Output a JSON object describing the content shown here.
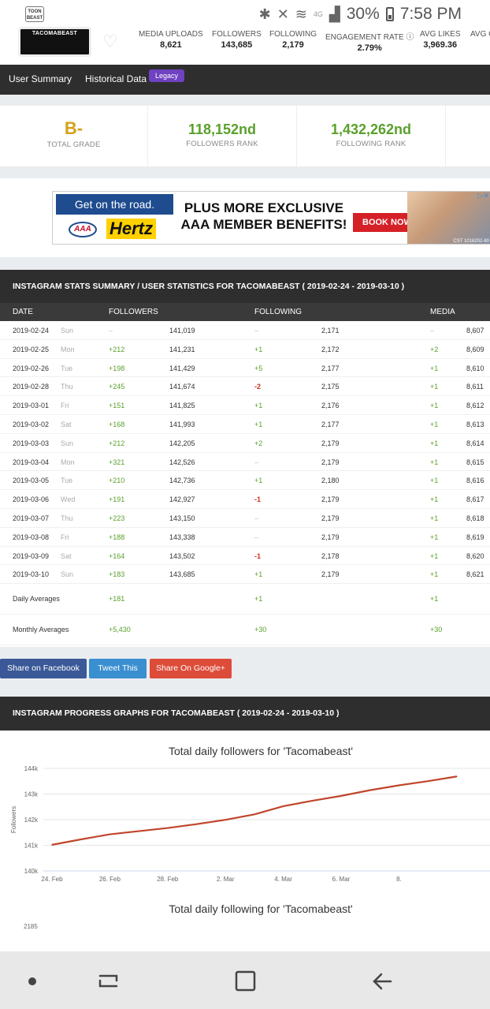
{
  "statusbar": {
    "battery": "30%",
    "time": "7:58 PM",
    "network": "4G",
    "app_badge": "TOON BEAST"
  },
  "profile": {
    "avatar_text": "TACOMABEAST",
    "stats": [
      {
        "label": "MEDIA UPLOADS",
        "value": "8,621"
      },
      {
        "label": "FOLLOWERS",
        "value": "143,685"
      },
      {
        "label": "FOLLOWING",
        "value": "2,179"
      },
      {
        "label": "ENGAGEMENT RATE",
        "value": "2.79%"
      },
      {
        "label": "AVG LIKES",
        "value": "3,969.36"
      },
      {
        "label": "AVG C",
        "value": ""
      }
    ]
  },
  "nav": {
    "user_summary": "User Summary",
    "historical": "Historical Data",
    "legacy": "Legacy"
  },
  "grades": {
    "total": {
      "value": "B-",
      "label": "TOTAL GRADE"
    },
    "followers_rank": {
      "value": "118,152nd",
      "label": "FOLLOWERS RANK"
    },
    "following_rank": {
      "value": "1,432,262nd",
      "label": "FOLLOWING RANK"
    }
  },
  "ad": {
    "line1": "Get on the road.",
    "brand_aaa": "AAA",
    "brand": "Hertz",
    "headline1": "PLUS MORE EXCLUSIVE",
    "headline2": "AAA MEMBER BENEFITS!",
    "cta": "BOOK NOW",
    "fine": "CST 1016202-80"
  },
  "stats_table": {
    "title": "INSTAGRAM STATS SUMMARY / USER STATISTICS FOR TACOMABEAST ( 2019-02-24 - 2019-03-10 )",
    "headers": {
      "date": "DATE",
      "followers": "FOLLOWERS",
      "following": "FOLLOWING",
      "media": "MEDIA"
    },
    "rows": [
      {
        "date": "2019-02-24",
        "day": "Sun",
        "fd": "–",
        "f": "141,019",
        "gd": "–",
        "g": "2,171",
        "md": "–",
        "m": "8,607"
      },
      {
        "date": "2019-02-25",
        "day": "Mon",
        "fd": "+212",
        "f": "141,231",
        "gd": "+1",
        "g": "2,172",
        "md": "+2",
        "m": "8,609"
      },
      {
        "date": "2019-02-26",
        "day": "Tue",
        "fd": "+198",
        "f": "141,429",
        "gd": "+5",
        "g": "2,177",
        "md": "+1",
        "m": "8,610"
      },
      {
        "date": "2019-02-28",
        "day": "Thu",
        "fd": "+245",
        "f": "141,674",
        "gd": "-2",
        "g": "2,175",
        "md": "+1",
        "m": "8,611"
      },
      {
        "date": "2019-03-01",
        "day": "Fri",
        "fd": "+151",
        "f": "141,825",
        "gd": "+1",
        "g": "2,176",
        "md": "+1",
        "m": "8,612"
      },
      {
        "date": "2019-03-02",
        "day": "Sat",
        "fd": "+168",
        "f": "141,993",
        "gd": "+1",
        "g": "2,177",
        "md": "+1",
        "m": "8,613"
      },
      {
        "date": "2019-03-03",
        "day": "Sun",
        "fd": "+212",
        "f": "142,205",
        "gd": "+2",
        "g": "2,179",
        "md": "+1",
        "m": "8,614"
      },
      {
        "date": "2019-03-04",
        "day": "Mon",
        "fd": "+321",
        "f": "142,526",
        "gd": "–",
        "g": "2,179",
        "md": "+1",
        "m": "8,615"
      },
      {
        "date": "2019-03-05",
        "day": "Tue",
        "fd": "+210",
        "f": "142,736",
        "gd": "+1",
        "g": "2,180",
        "md": "+1",
        "m": "8,616"
      },
      {
        "date": "2019-03-06",
        "day": "Wed",
        "fd": "+191",
        "f": "142,927",
        "gd": "-1",
        "g": "2,179",
        "md": "+1",
        "m": "8,617"
      },
      {
        "date": "2019-03-07",
        "day": "Thu",
        "fd": "+223",
        "f": "143,150",
        "gd": "–",
        "g": "2,179",
        "md": "+1",
        "m": "8,618"
      },
      {
        "date": "2019-03-08",
        "day": "Fri",
        "fd": "+188",
        "f": "143,338",
        "gd": "–",
        "g": "2,179",
        "md": "+1",
        "m": "8,619"
      },
      {
        "date": "2019-03-09",
        "day": "Sat",
        "fd": "+164",
        "f": "143,502",
        "gd": "-1",
        "g": "2,178",
        "md": "+1",
        "m": "8,620"
      },
      {
        "date": "2019-03-10",
        "day": "Sun",
        "fd": "+183",
        "f": "143,685",
        "gd": "+1",
        "g": "2,179",
        "md": "+1",
        "m": "8,621"
      }
    ],
    "daily_avg": {
      "label": "Daily Averages",
      "f": "+181",
      "g": "+1",
      "m": "+1"
    },
    "monthly_avg": {
      "label": "Monthly Averages",
      "f": "+5,430",
      "g": "+30",
      "m": "+30"
    }
  },
  "share": {
    "facebook": "Share on Facebook",
    "twitter": "Tweet This",
    "google": "Share On Google+"
  },
  "graphs": {
    "title": "INSTAGRAM PROGRESS GRAPHS FOR TACOMABEAST ( 2019-02-24 - 2019-03-10 )",
    "second_title": "Total daily following for 'Tacomabeast'",
    "second_first_tick": "2185"
  },
  "chart_data": {
    "type": "line",
    "title": "Total daily followers for 'Tacomabeast'",
    "xlabel": "",
    "ylabel": "Followers",
    "ylim": [
      140000,
      144000
    ],
    "y_ticks": [
      "140k",
      "141k",
      "142k",
      "143k",
      "144k"
    ],
    "x_ticks": [
      "24. Feb",
      "26. Feb",
      "28. Feb",
      "2. Mar",
      "4. Mar",
      "6. Mar",
      "8."
    ],
    "x": [
      "2019-02-24",
      "2019-02-25",
      "2019-02-26",
      "2019-02-28",
      "2019-03-01",
      "2019-03-02",
      "2019-03-03",
      "2019-03-04",
      "2019-03-05",
      "2019-03-06",
      "2019-03-07",
      "2019-03-08",
      "2019-03-09",
      "2019-03-10"
    ],
    "series": [
      {
        "values": [
          141019,
          141231,
          141429,
          141674,
          141825,
          141993,
          142205,
          142526,
          142736,
          142927,
          143150,
          143338,
          143502,
          143685
        ],
        "color": "#c0462c"
      }
    ],
    "grid": true
  },
  "colors": {
    "accent_green": "#5aa02c",
    "grade_gold": "#d4a017",
    "negative": "#d0301b",
    "dark_bar": "#2e2e2e",
    "legacy": "#6f42c1"
  }
}
